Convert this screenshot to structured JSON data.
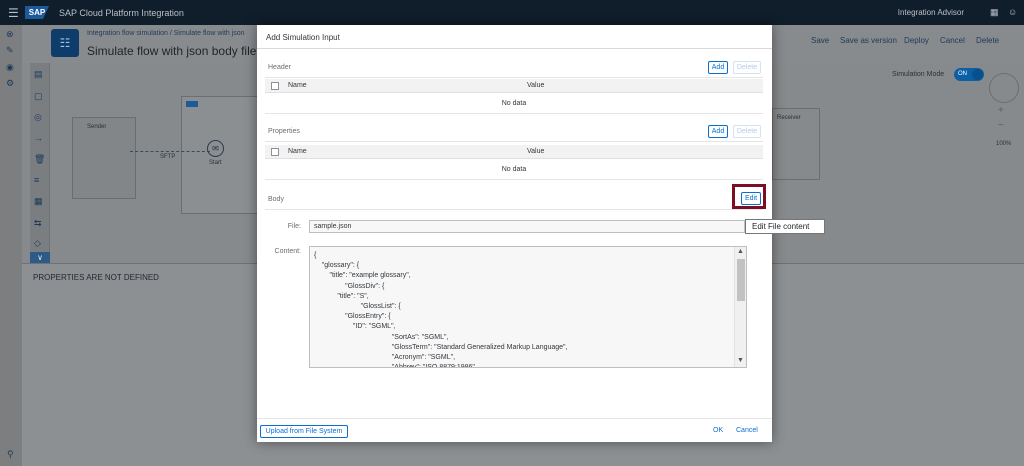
{
  "shell": {
    "menu_icon": "hamburger-icon",
    "logo_text": "SAP",
    "title": "SAP Cloud Platform Integration",
    "advisor_label": "Integration Advisor",
    "icons": [
      "grid-icon",
      "user-icon"
    ]
  },
  "left_rail": {
    "icons": [
      "discover-icon",
      "design-icon",
      "monitor-icon",
      "settings-icon"
    ]
  },
  "header": {
    "breadcrumb": "Integration flow simulation / Simulate flow with json",
    "page_title": "Simulate flow with json body file",
    "actions": {
      "save": "Save",
      "save_as_version": "Save as version",
      "deploy": "Deploy",
      "cancel": "Cancel",
      "delete": "Delete"
    }
  },
  "canvas": {
    "sender_label": "Sender",
    "sftp_label": "SFTP",
    "start_label": "Start",
    "receiver_label": "Receiver",
    "simulation_mode_label": "Simulation Mode",
    "toggle_label": "ON",
    "zoom_level": "100%"
  },
  "properties_panel": {
    "message": "PROPERTIES ARE NOT DEFINED"
  },
  "dialog": {
    "title": "Add Simulation Input",
    "header_section": {
      "label": "Header",
      "add_label": "Add",
      "delete_label": "Delete",
      "col_name": "Name",
      "col_value": "Value",
      "empty_text": "No data"
    },
    "properties_section": {
      "label": "Properties",
      "add_label": "Add",
      "delete_label": "Delete",
      "col_name": "Name",
      "col_value": "Value",
      "empty_text": "No data"
    },
    "body_section": {
      "label": "Body",
      "edit_label": "Edit",
      "edit_tooltip": "Edit File content",
      "file_label": "File:",
      "file_value": "sample.json",
      "content_label": "Content:",
      "content_text": "{\n    \"glossary\": {\n        \"title\": \"example glossary\",\n                \"GlossDiv\": {\n            \"title\": \"S\",\n                        \"GlossList\": {\n                \"GlossEntry\": {\n                    \"ID\": \"SGML\",\n                                        \"SortAs\": \"SGML\",\n                                        \"GlossTerm\": \"Standard Generalized Markup Language\",\n                                        \"Acronym\": \"SGML\",\n                                        \"Abbrev\": \"ISO 8879:1986\","
    },
    "footer": {
      "upload_label": "Upload from File System",
      "ok_label": "OK",
      "cancel_label": "Cancel"
    }
  }
}
